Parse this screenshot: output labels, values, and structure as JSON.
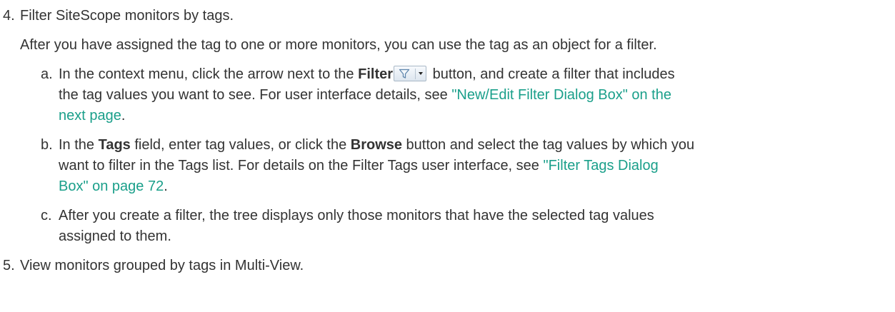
{
  "step4": {
    "number": "4.",
    "title": "Filter SiteScope monitors by tags.",
    "intro": "After you have assigned the tag to one or more monitors, you can use the tag as an object for a filter."
  },
  "substep_a": {
    "letter": "a.",
    "text1": "In the context menu, click the arrow next to the ",
    "bold1": "Filter",
    "text2": " button, and create a filter that includes",
    "line2": "the tag values you want to see. For user interface details, see ",
    "link1_part1": "\"New/Edit Filter Dialog Box\" on the",
    "link1_part2": "next page",
    "end": ".",
    "filter_icon": "filter-funnel-icon"
  },
  "substep_b": {
    "letter": "b.",
    "text1": "In the ",
    "bold1": "Tags",
    "text2": " field, enter tag values, or click the ",
    "bold2": "Browse",
    "text3": " button and select the tag values by which you",
    "line2": "want to filter in the Tags list. For details on the Filter Tags user interface, see ",
    "link_part1": "\"Filter Tags Dialog",
    "link_part2": "Box\" on page 72",
    "end": "."
  },
  "substep_c": {
    "letter": "c.",
    "line1": "After you create a filter, the tree displays only those monitors that have the selected tag values",
    "line2": "assigned to them."
  },
  "step5": {
    "number": "5.",
    "title": "View monitors grouped by tags in Multi-View."
  },
  "colors": {
    "text": "#333333",
    "link": "#1a9f8a"
  }
}
